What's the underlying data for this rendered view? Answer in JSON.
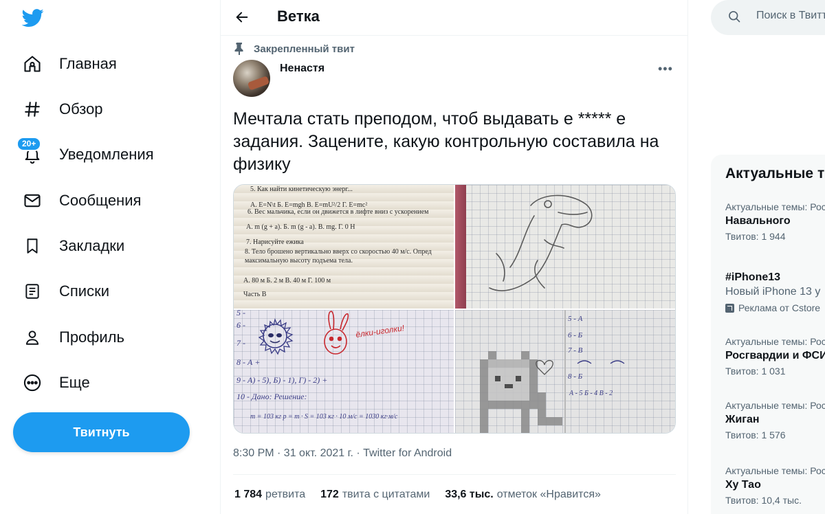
{
  "sidebar": {
    "items": [
      {
        "label": "Главная",
        "icon": "home-icon"
      },
      {
        "label": "Обзор",
        "icon": "hashtag-icon"
      },
      {
        "label": "Уведомления",
        "icon": "bell-icon",
        "badge": "20+"
      },
      {
        "label": "Сообщения",
        "icon": "mail-icon"
      },
      {
        "label": "Закладки",
        "icon": "bookmark-icon"
      },
      {
        "label": "Списки",
        "icon": "list-icon"
      },
      {
        "label": "Профиль",
        "icon": "person-icon"
      },
      {
        "label": "Еще",
        "icon": "more-circle-icon"
      }
    ],
    "tweet_button": "Твитнуть"
  },
  "header": {
    "title": "Ветка"
  },
  "tweet": {
    "pinned_label": "Закрепленный твит",
    "author": "Ненастя",
    "text": "Мечтала стать преподом, чтоб выдавать е ***** е задания. Зацените, какую контрольную составила на физику",
    "meta": "8:30 PM · 31 окт. 2021 г. · Twitter for Android",
    "stats": [
      {
        "value": "1 784",
        "label": "ретвита"
      },
      {
        "value": "172",
        "label": "твита с цитатами"
      },
      {
        "value": "33,6 тыс.",
        "label": "отметок «Нравится»"
      }
    ],
    "photos": {
      "p1": {
        "lines": [
          "5. Как найти кинетическую энерг...",
          "А. E=N\\t      Б. E=mgh      В. E=mU²/2      Г. E=mc²",
          "6. Вес мальчика, если он движется в лифте вниз с ускорением",
          "А. m (g + a).    Б. m (g - a).    В. mg.   Г. 0 Н",
          "7. Нарисуйте ежика",
          "8. Тело брошено вертикально вверх со скоростью 40 м/с. Опред",
          "максимальную высоту подъема тела.",
          "А. 80 м        Б. 2 м        В. 40 м        Г. 100 м",
          "Часть В"
        ]
      },
      "p3": {
        "caption": "ёлки-иголки!",
        "lines": [
          "5 -",
          "6 -",
          "7 -",
          "8 - А +",
          "9 - А) - 5), Б) - 1), Г) - 2)  +",
          "10 - Дано:    Решение:",
          "m = 103 кг     p = m · S = 103 кг · 10 м/с = 1030 кг·м/с"
        ]
      },
      "p4": {
        "letters": [
          "5 - А",
          "6 - Б",
          "7 - В",
          "8 - Б",
          "А - 5   Б - 4   В - 2"
        ]
      }
    }
  },
  "search": {
    "placeholder": "Поиск в Твиттере"
  },
  "trends": {
    "title": "Актуальные темы",
    "items": [
      {
        "category": "Актуальные темы: Россия",
        "name": "Навального",
        "count": "Твитов: 1 944"
      },
      {
        "category": "",
        "name": "#iPhone13",
        "subtitle": "Новый iPhone 13 у",
        "promoted": "Реклама от Cstore"
      },
      {
        "category": "Актуальные темы: Россия",
        "name": "Росгвардии и ФСИН",
        "count": "Твитов: 1 031"
      },
      {
        "category": "Актуальные темы: Россия",
        "name": "Жиган",
        "count": "Твитов: 1 576"
      },
      {
        "category": "Актуальные темы: Россия",
        "name": "Ху Тао",
        "count": "Твитов: 10,4 тыс."
      }
    ]
  },
  "colors": {
    "accent": "#1d9bf0",
    "text": "#0f1419",
    "secondary": "#536471",
    "border": "#eff3f4"
  }
}
